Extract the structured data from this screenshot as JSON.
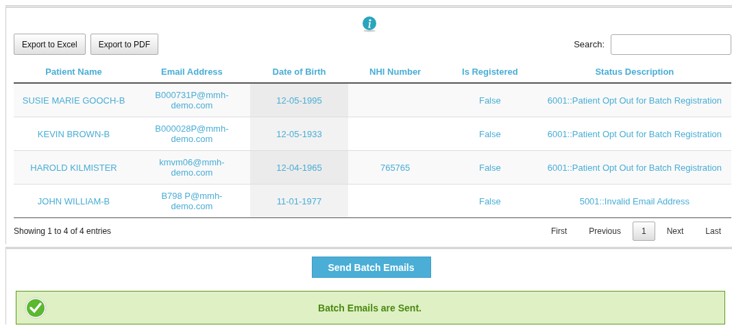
{
  "toolbar": {
    "buttons": [
      "Export to Excel",
      "Export to PDF"
    ],
    "search": {
      "label": "Search:"
    }
  },
  "table": {
    "columns": [
      {
        "label": "Patient Name",
        "sorted": false
      },
      {
        "label": "Email Address",
        "sorted": false
      },
      {
        "label": "Date of Birth",
        "sorted": true
      },
      {
        "label": "NHI Number",
        "sorted": false
      },
      {
        "label": "Is Registered",
        "sorted": false
      },
      {
        "label": "Status Description",
        "sorted": false
      }
    ],
    "rows": [
      {
        "cells": [
          "SUSIE MARIE GOOCH-B",
          "B000731P@mmh-demo.com",
          "12-05-1995",
          "",
          "False",
          "6001::Patient Opt Out for Batch Registration"
        ]
      },
      {
        "cells": [
          "KEVIN BROWN-B",
          "B000028P@mmh-demo.com",
          "12-05-1933",
          "",
          "False",
          "6001::Patient Opt Out for Batch Registration"
        ]
      },
      {
        "cells": [
          "HAROLD KILMISTER",
          "kmvm06@mmh-demo.com",
          "12-04-1965",
          "765765",
          "False",
          "6001::Patient Opt Out for Batch Registration"
        ]
      },
      {
        "cells": [
          "JOHN WILLIAM-B",
          "B798 P@mmh-demo.com",
          "11-01-1977",
          "",
          "False",
          "5001::Invalid Email Address"
        ]
      }
    ]
  },
  "info": "Showing 1 to 4 of 4 entries",
  "pagination": [
    {
      "label": "First",
      "selected": false
    },
    {
      "label": "Previous",
      "selected": false
    },
    {
      "label": "1",
      "selected": true
    },
    {
      "label": "Next",
      "selected": false
    },
    {
      "label": "Last",
      "selected": false
    }
  ],
  "send_button": "Send Batch Emails",
  "alert": {
    "kind": "success",
    "message": "Batch Emails are Sent."
  }
}
